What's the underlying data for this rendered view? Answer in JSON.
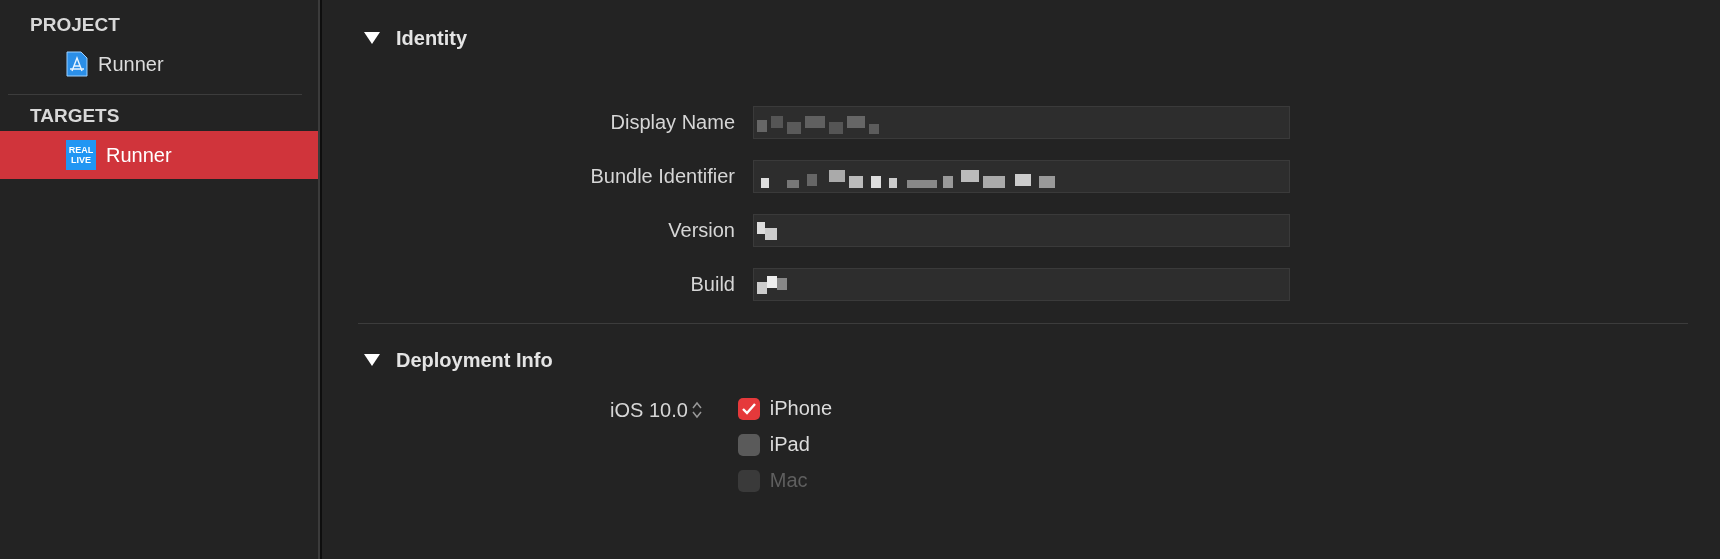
{
  "sidebar": {
    "sections": [
      {
        "title": "PROJECT",
        "items": [
          {
            "label": "Runner",
            "kind": "project",
            "selected": false
          }
        ]
      },
      {
        "title": "TARGETS",
        "items": [
          {
            "label": "Runner",
            "kind": "app",
            "icon_text": [
              "REAL",
              "LIVE"
            ],
            "selected": true
          }
        ]
      }
    ]
  },
  "identity": {
    "title": "Identity",
    "expanded": true,
    "fields": [
      {
        "label": "Display Name",
        "redacted": true
      },
      {
        "label": "Bundle Identifier",
        "redacted": true
      },
      {
        "label": "Version",
        "redacted": true
      },
      {
        "label": "Build",
        "redacted": true
      }
    ]
  },
  "deployment": {
    "title": "Deployment Info",
    "expanded": true,
    "target": "iOS 10.0",
    "devices": [
      {
        "label": "iPhone",
        "checked": true,
        "disabled": false
      },
      {
        "label": "iPad",
        "checked": false,
        "disabled": false
      },
      {
        "label": "Mac",
        "checked": false,
        "disabled": true
      }
    ]
  }
}
